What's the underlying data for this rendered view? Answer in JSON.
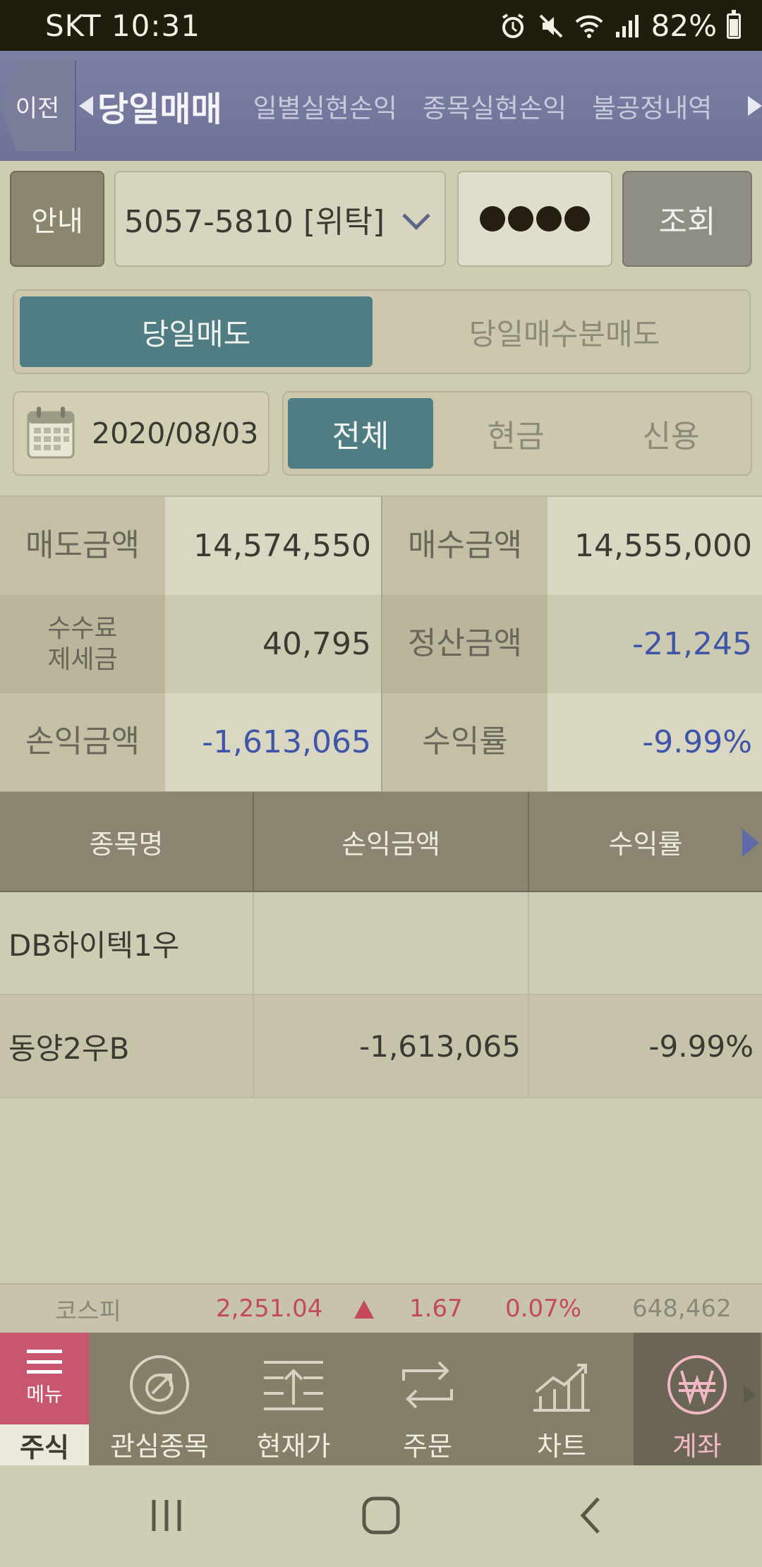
{
  "status": {
    "carrier_time": "SKT 10:31",
    "battery": "82%"
  },
  "header": {
    "back_label": "이전",
    "tabs": [
      {
        "label": "당일매매",
        "active": true
      },
      {
        "label": "일별실현손익",
        "active": false
      },
      {
        "label": "종목실현손익",
        "active": false
      },
      {
        "label": "불공정내역",
        "active": false
      }
    ]
  },
  "account": {
    "guide_label": "안내",
    "number": "5057-5810 [위탁]",
    "query_label": "조회"
  },
  "segment": {
    "sell_today": "당일매도",
    "buy_today_sell": "당일매수분매도"
  },
  "filter": {
    "date": "2020/08/03",
    "options": [
      "전체",
      "현금",
      "신용"
    ],
    "selected": "전체"
  },
  "summary": {
    "sell_amount_label": "매도금액",
    "sell_amount": "14,574,550",
    "buy_amount_label": "매수금액",
    "buy_amount": "14,555,000",
    "fee_label_1": "수수료",
    "fee_label_2": "제세금",
    "fee": "40,795",
    "settle_label": "정산금액",
    "settle": "-21,245",
    "pl_label": "손익금액",
    "pl": "-1,613,065",
    "rate_label": "수익률",
    "rate": "-9.99%"
  },
  "table": {
    "headers": [
      "종목명",
      "손익금액",
      "수익률"
    ],
    "rows": [
      {
        "name": "DB하이텍1우",
        "pl": "",
        "rate": ""
      },
      {
        "name": "동양2우B",
        "pl": "-1,613,065",
        "rate": "-9.99%"
      }
    ]
  },
  "ticker": {
    "name": "코스피",
    "value": "2,251.04",
    "change": "1.67",
    "percent": "0.07%",
    "volume": "648,462"
  },
  "bottom_nav": {
    "menu_label": "메뉴",
    "stock_label": "주식",
    "items": [
      "관심종목",
      "현재가",
      "주문",
      "차트",
      "계좌"
    ],
    "active": "계좌"
  },
  "colors": {
    "accent_teal": "#4f7d83",
    "negative": "#3f56a8",
    "positive": "#c44a5a",
    "header": "#7c80a3"
  }
}
